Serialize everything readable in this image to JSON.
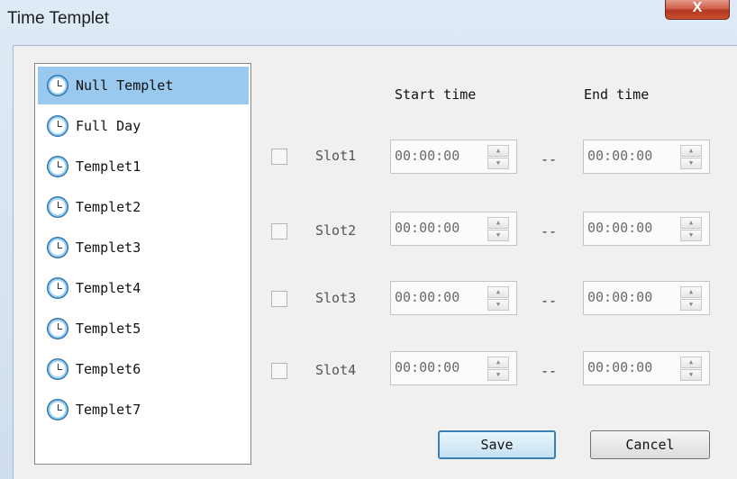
{
  "window": {
    "title": "Time Templet",
    "close_label": "X"
  },
  "templates": [
    {
      "label": "Null Templet",
      "selected": true
    },
    {
      "label": "Full Day",
      "selected": false
    },
    {
      "label": "Templet1",
      "selected": false
    },
    {
      "label": "Templet2",
      "selected": false
    },
    {
      "label": "Templet3",
      "selected": false
    },
    {
      "label": "Templet4",
      "selected": false
    },
    {
      "label": "Templet5",
      "selected": false
    },
    {
      "label": "Templet6",
      "selected": false
    },
    {
      "label": "Templet7",
      "selected": false
    }
  ],
  "columns": {
    "start": "Start time",
    "end": "End time"
  },
  "separator": "--",
  "slots": [
    {
      "label": "Slot1",
      "start": "00:00:00",
      "end": "00:00:00",
      "checked": false
    },
    {
      "label": "Slot2",
      "start": "00:00:00",
      "end": "00:00:00",
      "checked": false
    },
    {
      "label": "Slot3",
      "start": "00:00:00",
      "end": "00:00:00",
      "checked": false
    },
    {
      "label": "Slot4",
      "start": "00:00:00",
      "end": "00:00:00",
      "checked": false
    }
  ],
  "buttons": {
    "save": "Save",
    "cancel": "Cancel"
  },
  "icons": {
    "template_item": "clock-icon",
    "spin_up": "spin-up-icon",
    "spin_down": "spin-down-icon"
  }
}
